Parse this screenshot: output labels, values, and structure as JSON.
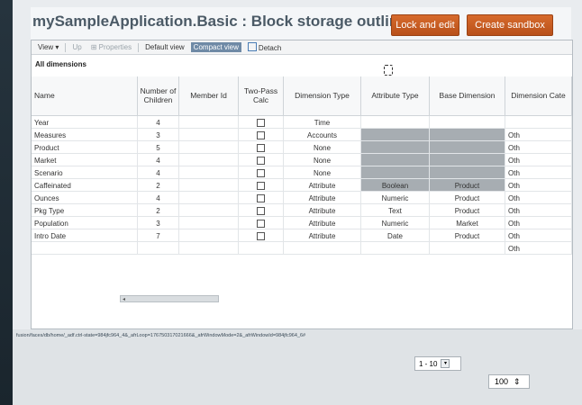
{
  "app": {
    "title": "mySampleApplication.Basic : Block storage outline",
    "lock_label": "Lock and edit",
    "sandbox_label": "Create sandbox"
  },
  "toolbar": {
    "view": "View",
    "up": "Up",
    "properties": "Properties",
    "default_view": "Default view",
    "compact_view": "Compact view",
    "detach": "Detach"
  },
  "section": {
    "label": "All dimensions"
  },
  "columns": {
    "name": "Name",
    "children": "Number of Children",
    "member_id": "Member Id",
    "two_pass": "Two-Pass Calc",
    "dim_type": "Dimension Type",
    "attr_type": "Attribute Type",
    "base_dim": "Base Dimension",
    "dim_cat": "Dimension Cate"
  },
  "rows": [
    {
      "name": "Year",
      "children": "4",
      "dim_type": "Time",
      "attr_type": "",
      "base_dim": "",
      "dim_cat": ""
    },
    {
      "name": "Measures",
      "children": "3",
      "dim_type": "Accounts",
      "attr_type": "",
      "base_dim": "",
      "dim_cat": "Oth"
    },
    {
      "name": "Product",
      "children": "5",
      "dim_type": "None",
      "attr_type": "",
      "base_dim": "",
      "dim_cat": "Oth"
    },
    {
      "name": "Market",
      "children": "4",
      "dim_type": "None",
      "attr_type": "",
      "base_dim": "",
      "dim_cat": "Oth"
    },
    {
      "name": "Scenario",
      "children": "4",
      "dim_type": "None",
      "attr_type": "",
      "base_dim": "",
      "dim_cat": "Oth"
    },
    {
      "name": "Caffeinated",
      "children": "2",
      "dim_type": "Attribute",
      "attr_type": "Boolean",
      "base_dim": "Product",
      "dim_cat": "Oth"
    },
    {
      "name": "Ounces",
      "children": "4",
      "dim_type": "Attribute",
      "attr_type": "Numeric",
      "base_dim": "Product",
      "dim_cat": "Oth"
    },
    {
      "name": "Pkg Type",
      "children": "2",
      "dim_type": "Attribute",
      "attr_type": "Text",
      "base_dim": "Product",
      "dim_cat": "Oth"
    },
    {
      "name": "Population",
      "children": "3",
      "dim_type": "Attribute",
      "attr_type": "Numeric",
      "base_dim": "Market",
      "dim_cat": "Oth"
    },
    {
      "name": "Intro Date",
      "children": "7",
      "dim_type": "Attribute",
      "attr_type": "Date",
      "base_dim": "Product",
      "dim_cat": "Oth"
    },
    {
      "name": "",
      "children": "",
      "dim_type": "",
      "attr_type": "",
      "base_dim": "",
      "dim_cat": "Oth"
    }
  ],
  "status": {
    "url": "fusion/faces/db/home/_adf.ctrl-state=984jfc964_4&_afrLoop=176750317021666&_afrWindowMode=2&_afrWindowId=984jfc964_6#",
    "pager": "1 - 10",
    "zoom": "100"
  },
  "colors": {
    "accent": "#c75a22",
    "title": "#4b5a66",
    "selected": "#6f8aa6",
    "shade": "#a7adb2"
  }
}
